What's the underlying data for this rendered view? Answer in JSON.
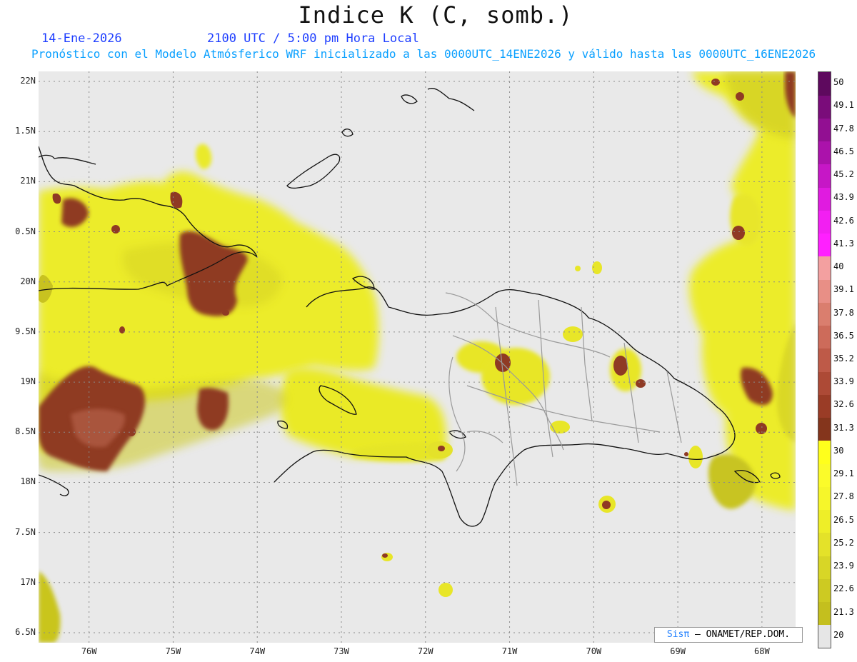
{
  "header": {
    "title": "Indice K (C, somb.)",
    "date": "14-Ene-2026",
    "time": "2100 UTC / 5:00 pm Hora Local",
    "model_text": "Pronóstico con el Modelo Atmósferico WRF inicializado a las 0000UTC_14ENE2026 y válido hasta las  0000UTC_16ENE2026"
  },
  "map": {
    "lon_range": [
      -76.6,
      -67.6
    ],
    "lat_range": [
      16.4,
      22.1
    ],
    "lat_labels": [
      {
        "value": 22,
        "label": "22N"
      },
      {
        "value": 21.5,
        "label": "1.5N"
      },
      {
        "value": 21,
        "label": "21N"
      },
      {
        "value": 20.5,
        "label": "0.5N"
      },
      {
        "value": 20,
        "label": "20N"
      },
      {
        "value": 19.5,
        "label": "9.5N"
      },
      {
        "value": 19,
        "label": "19N"
      },
      {
        "value": 18.5,
        "label": "8.5N"
      },
      {
        "value": 18,
        "label": "18N"
      },
      {
        "value": 17.5,
        "label": "7.5N"
      },
      {
        "value": 17,
        "label": "17N"
      },
      {
        "value": 16.5,
        "label": "6.5N"
      }
    ],
    "lon_labels": [
      {
        "value": -76,
        "label": "76W"
      },
      {
        "value": -75,
        "label": "75W"
      },
      {
        "value": -74,
        "label": "74W"
      },
      {
        "value": -73,
        "label": "73W"
      },
      {
        "value": -72,
        "label": "72W"
      },
      {
        "value": -71,
        "label": "71W"
      },
      {
        "value": -70,
        "label": "70W"
      },
      {
        "value": -69,
        "label": "69W"
      },
      {
        "value": -68,
        "label": "68W"
      }
    ],
    "background_color": "#e9e9e9",
    "grid": true
  },
  "colorbar": {
    "levels": [
      "20",
      "21.3",
      "22.6",
      "23.9",
      "25.2",
      "26.5",
      "27.8",
      "29.1",
      "30",
      "31.3",
      "32.6",
      "33.9",
      "35.2",
      "36.5",
      "37.8",
      "39.1",
      "40",
      "41.3",
      "42.6",
      "43.9",
      "45.2",
      "46.5",
      "47.8",
      "49.1",
      "50"
    ],
    "colors": [
      "#e6e6e6",
      "#c4bf1e",
      "#cdca22",
      "#d8d626",
      "#e4e229",
      "#eeee28",
      "#f6f62a",
      "#fbfb2a",
      "#ffff1c",
      "#84351c",
      "#9a3c26",
      "#ad4a36",
      "#be5a48",
      "#cd6b5a",
      "#da7e6e",
      "#e88f86",
      "#f3a0a0",
      "#ff20ff",
      "#f21ff2",
      "#e01be0",
      "#c617c6",
      "#ab12ab",
      "#920f92",
      "#7a0c7a",
      "#5e095e"
    ]
  },
  "credit": {
    "logo": "Sisπ",
    "text": "– ONAMET/REP.DOM."
  }
}
